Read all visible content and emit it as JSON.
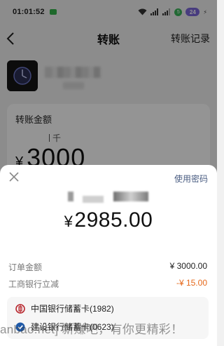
{
  "status_bar": {
    "time": "01:01:52",
    "battery": "24",
    "sim_tag": "5"
  },
  "nav": {
    "title": "转账",
    "record_link": "转账记录"
  },
  "amount_card": {
    "label": "转账金额",
    "unit_hint": "千",
    "currency": "¥",
    "amount": "3000"
  },
  "sheet": {
    "use_password": "使用密码",
    "currency": "¥",
    "pay_amount": "2985.00",
    "rows": [
      {
        "label": "订单金额",
        "value": "¥ 3000.00"
      },
      {
        "label": "工商银行立减",
        "value": "-¥ 15.00"
      }
    ],
    "methods": [
      {
        "label": "中国银行储蓄卡(1982)"
      },
      {
        "label": "建设银行储蓄卡(0623)"
      }
    ]
  },
  "watermark": "anbao.net] 新赚吧，有你更精彩！",
  "colors": {
    "accent_link": "#4a5d82",
    "discount": "#e6691b",
    "battery": "#7c68d9"
  }
}
